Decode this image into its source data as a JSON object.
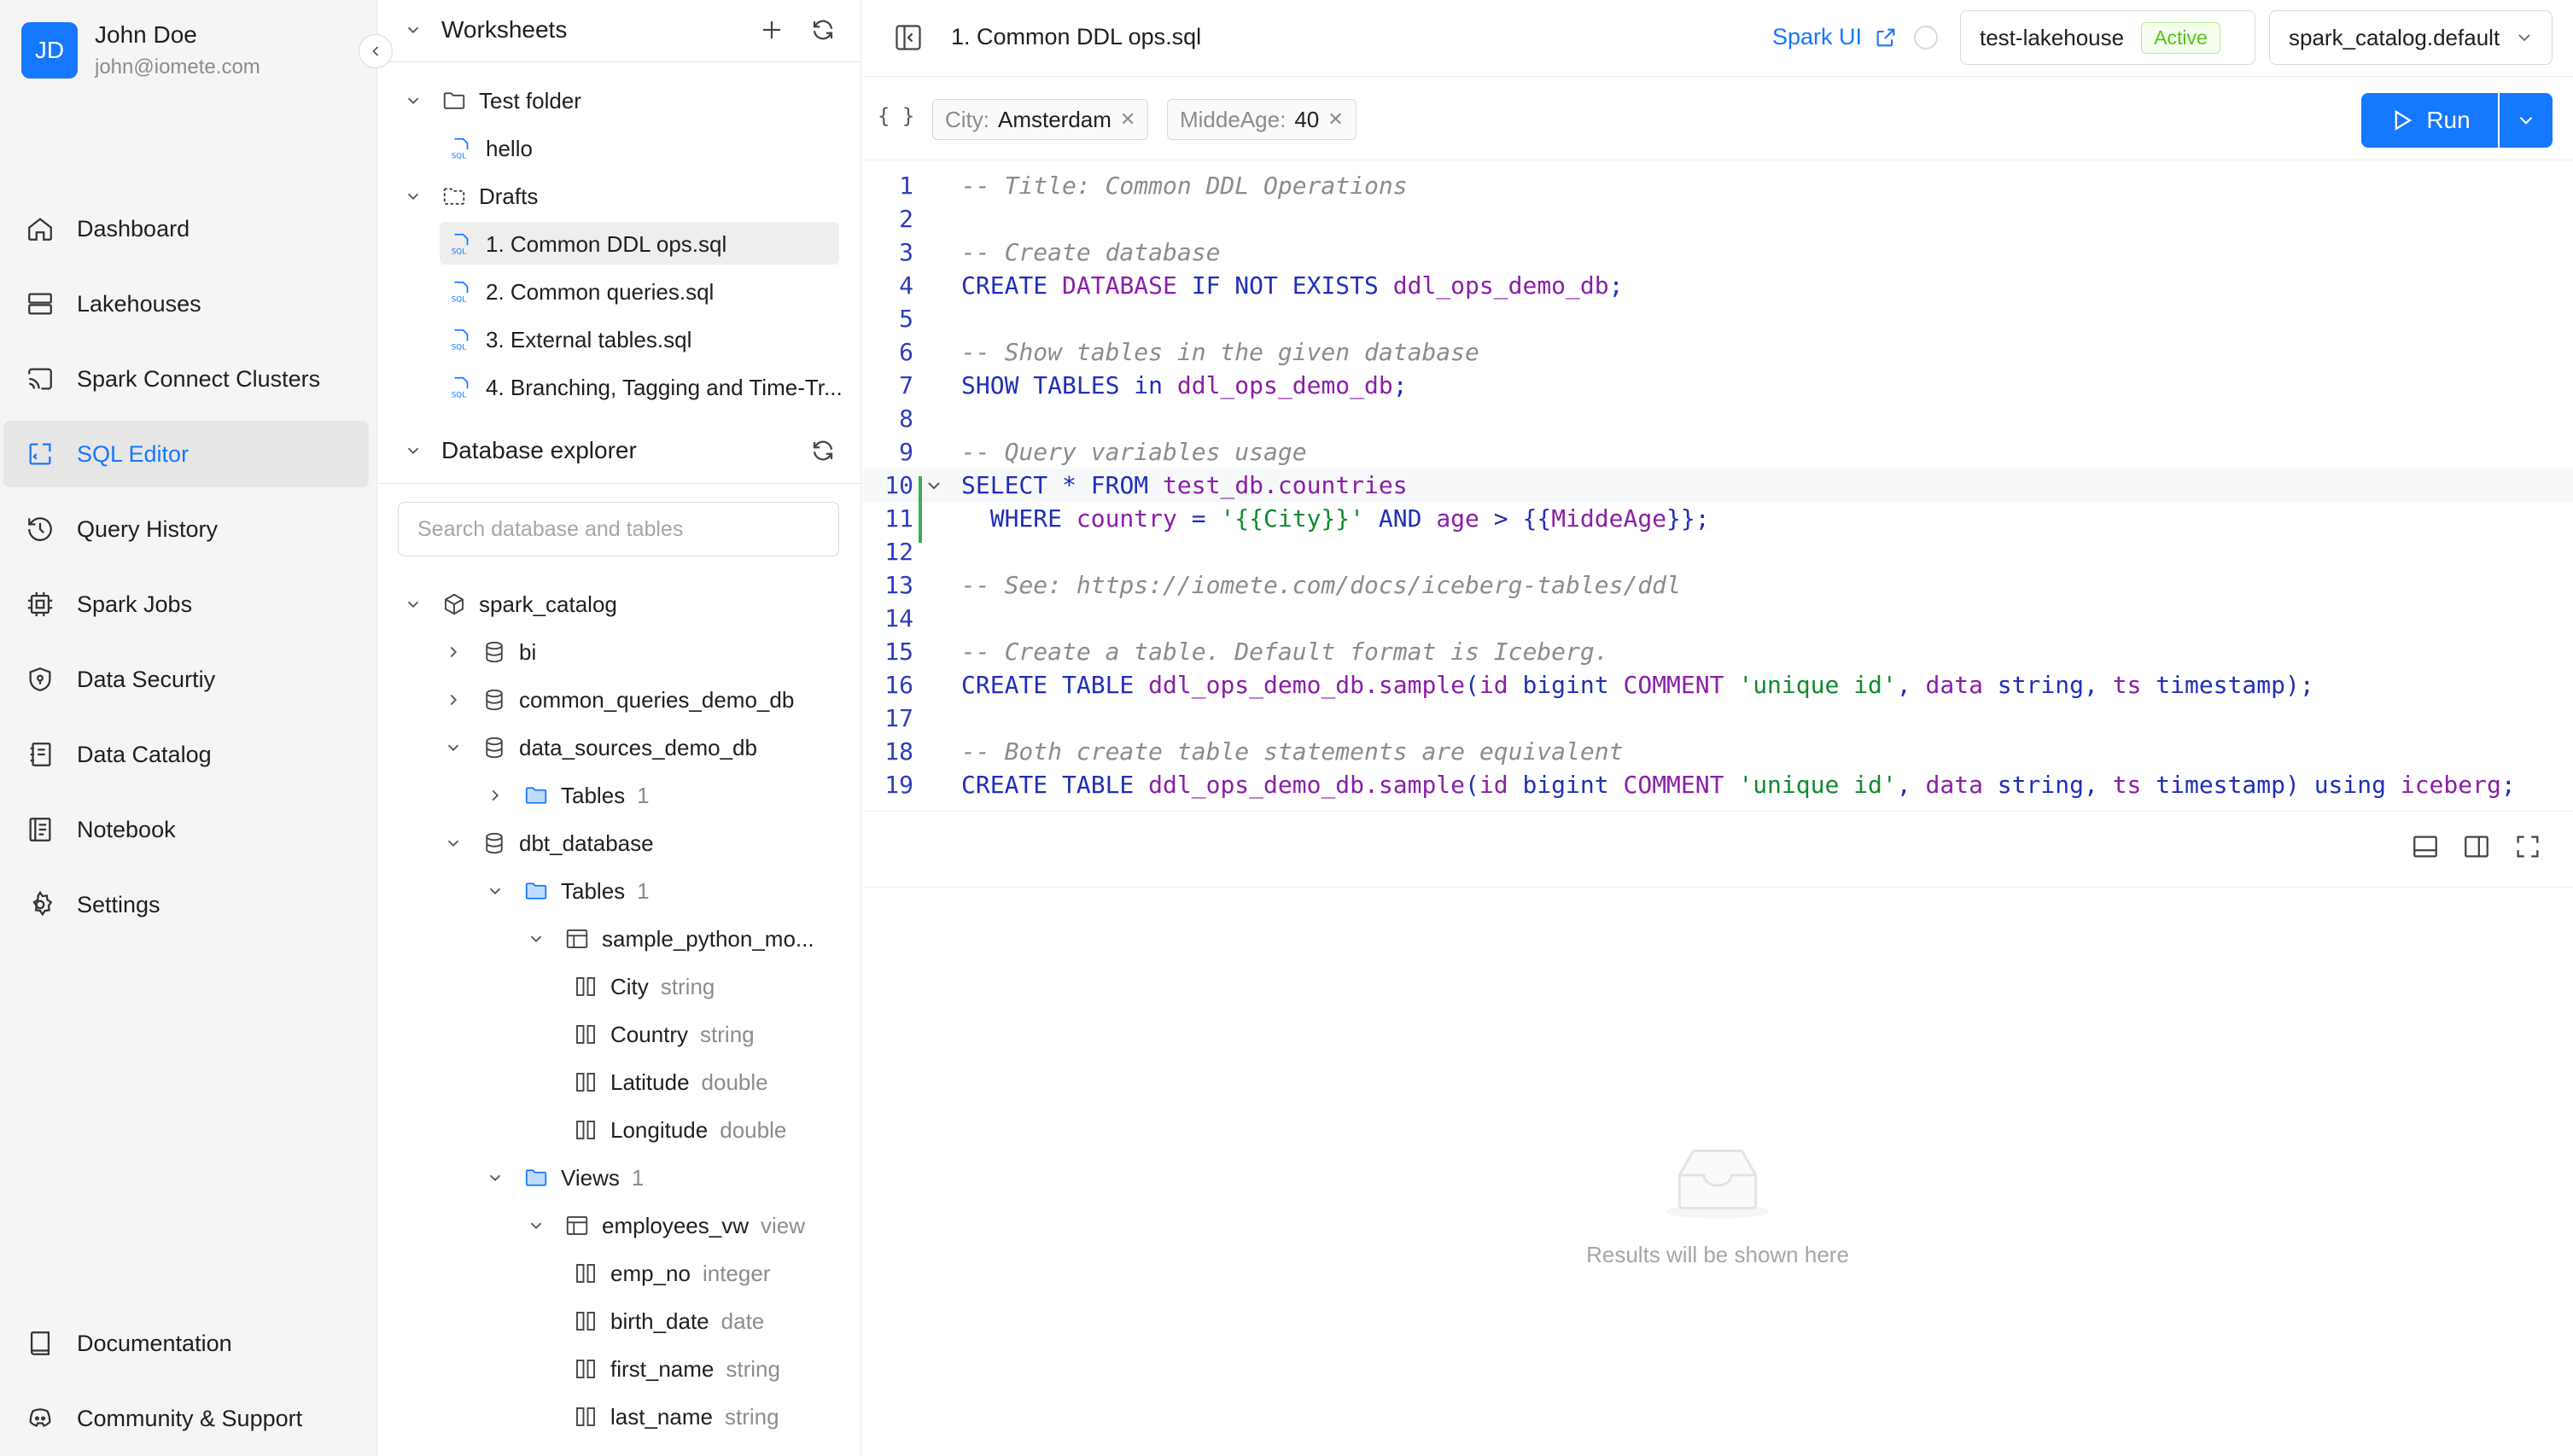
{
  "user": {
    "initials": "JD",
    "name": "John Doe",
    "email": "john@iomete.com"
  },
  "nav": {
    "items": [
      {
        "label": "Dashboard",
        "icon": "home-icon"
      },
      {
        "label": "Lakehouses",
        "icon": "server-icon"
      },
      {
        "label": "Spark Connect Clusters",
        "icon": "cast-icon"
      },
      {
        "label": "SQL Editor",
        "icon": "code-icon",
        "active": true
      },
      {
        "label": "Query History",
        "icon": "history-icon"
      },
      {
        "label": "Spark Jobs",
        "icon": "chip-icon"
      },
      {
        "label": "Data Securtiy",
        "icon": "shield-icon"
      },
      {
        "label": "Data Catalog",
        "icon": "catalog-icon"
      },
      {
        "label": "Notebook",
        "icon": "notebook-icon"
      },
      {
        "label": "Settings",
        "icon": "gear-icon"
      }
    ],
    "bottom": [
      {
        "label": "Documentation",
        "icon": "book-icon"
      },
      {
        "label": "Community & Support",
        "icon": "discord-icon"
      }
    ]
  },
  "worksheets": {
    "title": "Worksheets",
    "items": [
      {
        "label": "Test folder",
        "kind": "folder"
      },
      {
        "label": "hello",
        "kind": "sql"
      },
      {
        "label": "Drafts",
        "kind": "drafts"
      },
      {
        "label": "1. Common DDL ops.sql",
        "kind": "sql",
        "selected": true
      },
      {
        "label": "2. Common queries.sql",
        "kind": "sql"
      },
      {
        "label": "3. External tables.sql",
        "kind": "sql"
      },
      {
        "label": "4. Branching, Tagging and Time-Tr...",
        "kind": "sql"
      }
    ]
  },
  "explorer": {
    "title": "Database explorer",
    "search_placeholder": "Search database and tables",
    "tree": [
      {
        "label": "spark_catalog",
        "meta": ""
      },
      {
        "label": "bi",
        "meta": ""
      },
      {
        "label": "common_queries_demo_db",
        "meta": ""
      },
      {
        "label": "data_sources_demo_db",
        "meta": ""
      },
      {
        "label": "Tables",
        "meta": "1"
      },
      {
        "label": "dbt_database",
        "meta": ""
      },
      {
        "label": "Tables",
        "meta": "1"
      },
      {
        "label": "sample_python_mo...",
        "meta": ""
      },
      {
        "label": "City",
        "meta": "string"
      },
      {
        "label": "Country",
        "meta": "string"
      },
      {
        "label": "Latitude",
        "meta": "double"
      },
      {
        "label": "Longitude",
        "meta": "double"
      },
      {
        "label": "Views",
        "meta": "1"
      },
      {
        "label": "employees_vw",
        "meta": "view"
      },
      {
        "label": "emp_no",
        "meta": "integer"
      },
      {
        "label": "birth_date",
        "meta": "date"
      },
      {
        "label": "first_name",
        "meta": "string"
      },
      {
        "label": "last_name",
        "meta": "string"
      }
    ]
  },
  "editor": {
    "tab_title": "1. Common DDL ops.sql",
    "spark_ui": "Spark UI",
    "cluster": {
      "name": "test-lakehouse",
      "status": "Active"
    },
    "catalog": "spark_catalog.default",
    "params_icon": "{ }",
    "params": [
      {
        "key": "City:",
        "value": "Amsterdam"
      },
      {
        "key": "MiddeAge:",
        "value": "40"
      }
    ],
    "run_label": "Run",
    "lines": [
      [
        [
          "-- Title: Common DDL Operations",
          "cm"
        ]
      ],
      [],
      [
        [
          "-- Create database",
          "cm"
        ]
      ],
      [
        [
          "CREATE ",
          "kw"
        ],
        [
          "DATABASE ",
          "mg"
        ],
        [
          "IF NOT EXISTS ",
          "kw"
        ],
        [
          "ddl_ops_demo_db",
          "mg"
        ],
        [
          ";",
          "kw"
        ]
      ],
      [],
      [
        [
          "-- Show tables in the given database",
          "cm"
        ]
      ],
      [
        [
          "SHOW TABLES ",
          "kw"
        ],
        [
          "in ",
          "kw"
        ],
        [
          "ddl_ops_demo_db",
          "mg"
        ],
        [
          ";",
          "kw"
        ]
      ],
      [],
      [
        [
          "-- Query variables usage",
          "cm"
        ]
      ],
      [
        [
          "SELECT ",
          "kw"
        ],
        [
          "* ",
          "kw"
        ],
        [
          "FROM ",
          "kw"
        ],
        [
          "test_db.countries",
          "mg"
        ]
      ],
      [
        [
          "  WHERE ",
          "kw"
        ],
        [
          "country ",
          "mg"
        ],
        [
          "= ",
          "kw"
        ],
        [
          "'{{City}}'",
          "st"
        ],
        [
          " AND ",
          "kw"
        ],
        [
          "age ",
          "mg"
        ],
        [
          "> ",
          "kw"
        ],
        [
          "{{",
          "kw"
        ],
        [
          "MiddeAge",
          "mg"
        ],
        [
          "}};",
          "kw"
        ]
      ],
      [],
      [
        [
          "-- See: https://iomete.com/docs/iceberg-tables/ddl",
          "cm"
        ]
      ],
      [],
      [
        [
          "-- Create a table. Default format is Iceberg.",
          "cm"
        ]
      ],
      [
        [
          "CREATE TABLE ",
          "kw"
        ],
        [
          "ddl_ops_demo_db.sample",
          "mg"
        ],
        [
          "(",
          "kw"
        ],
        [
          "id ",
          "mg"
        ],
        [
          "bigint ",
          "kw"
        ],
        [
          "COMMENT ",
          "mg"
        ],
        [
          "'unique id'",
          "st"
        ],
        [
          ", ",
          "kw"
        ],
        [
          "data ",
          "mg"
        ],
        [
          "string",
          "kw"
        ],
        [
          ", ",
          "kw"
        ],
        [
          "ts ",
          "mg"
        ],
        [
          "timestamp",
          "kw"
        ],
        [
          ");",
          "kw"
        ]
      ],
      [],
      [
        [
          "-- Both create table statements are equivalent",
          "cm"
        ]
      ],
      [
        [
          "CREATE TABLE ",
          "kw"
        ],
        [
          "ddl_ops_demo_db.sample",
          "mg"
        ],
        [
          "(",
          "kw"
        ],
        [
          "id ",
          "mg"
        ],
        [
          "bigint ",
          "kw"
        ],
        [
          "COMMENT ",
          "mg"
        ],
        [
          "'unique id'",
          "st"
        ],
        [
          ", ",
          "kw"
        ],
        [
          "data ",
          "mg"
        ],
        [
          "string",
          "kw"
        ],
        [
          ", ",
          "kw"
        ],
        [
          "ts ",
          "mg"
        ],
        [
          "timestamp",
          "kw"
        ],
        [
          ") ",
          "kw"
        ],
        [
          "using ",
          "kw"
        ],
        [
          "iceberg",
          "mg"
        ],
        [
          ";",
          "kw"
        ]
      ]
    ],
    "results_placeholder": "Results will be shown here"
  }
}
